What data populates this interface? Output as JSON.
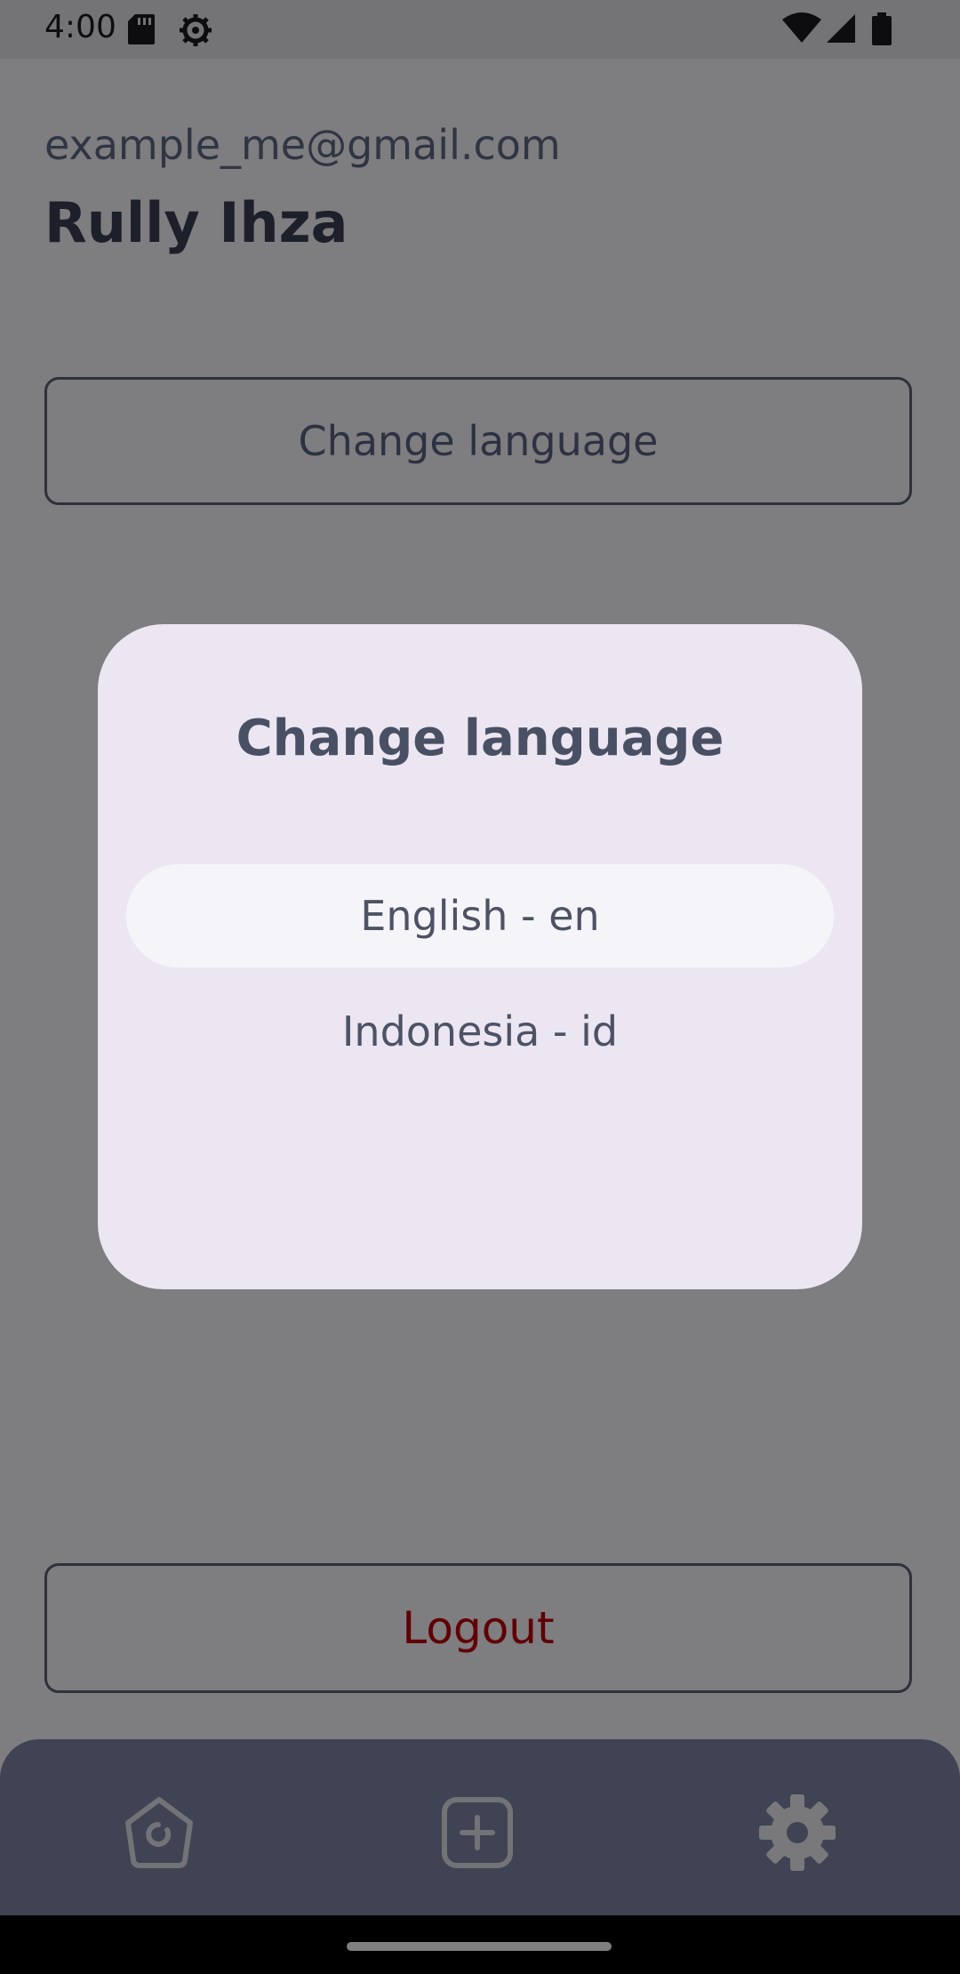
{
  "status_bar": {
    "time": "4:00",
    "icons": [
      "sd-card-icon",
      "settings-gear-icon",
      "wifi-icon",
      "signal-icon",
      "battery-icon"
    ]
  },
  "profile": {
    "email": "example_me@gmail.com",
    "name": "Rully Ihza"
  },
  "buttons": {
    "change_language": "Change language",
    "logout": "Logout"
  },
  "dialog": {
    "title": "Change language",
    "options": [
      {
        "label": "English - en",
        "selected": true
      },
      {
        "label": "Indonesia - id",
        "selected": false
      }
    ]
  },
  "bottom_nav": {
    "items": [
      {
        "icon": "home-icon",
        "active": false
      },
      {
        "icon": "add-box-icon",
        "active": false
      },
      {
        "icon": "gear-icon",
        "active": true
      }
    ]
  },
  "colors": {
    "logout_text": "#c1000a",
    "dialog_bg": "#ece6f2",
    "nav_bg": "#7f87a7"
  }
}
